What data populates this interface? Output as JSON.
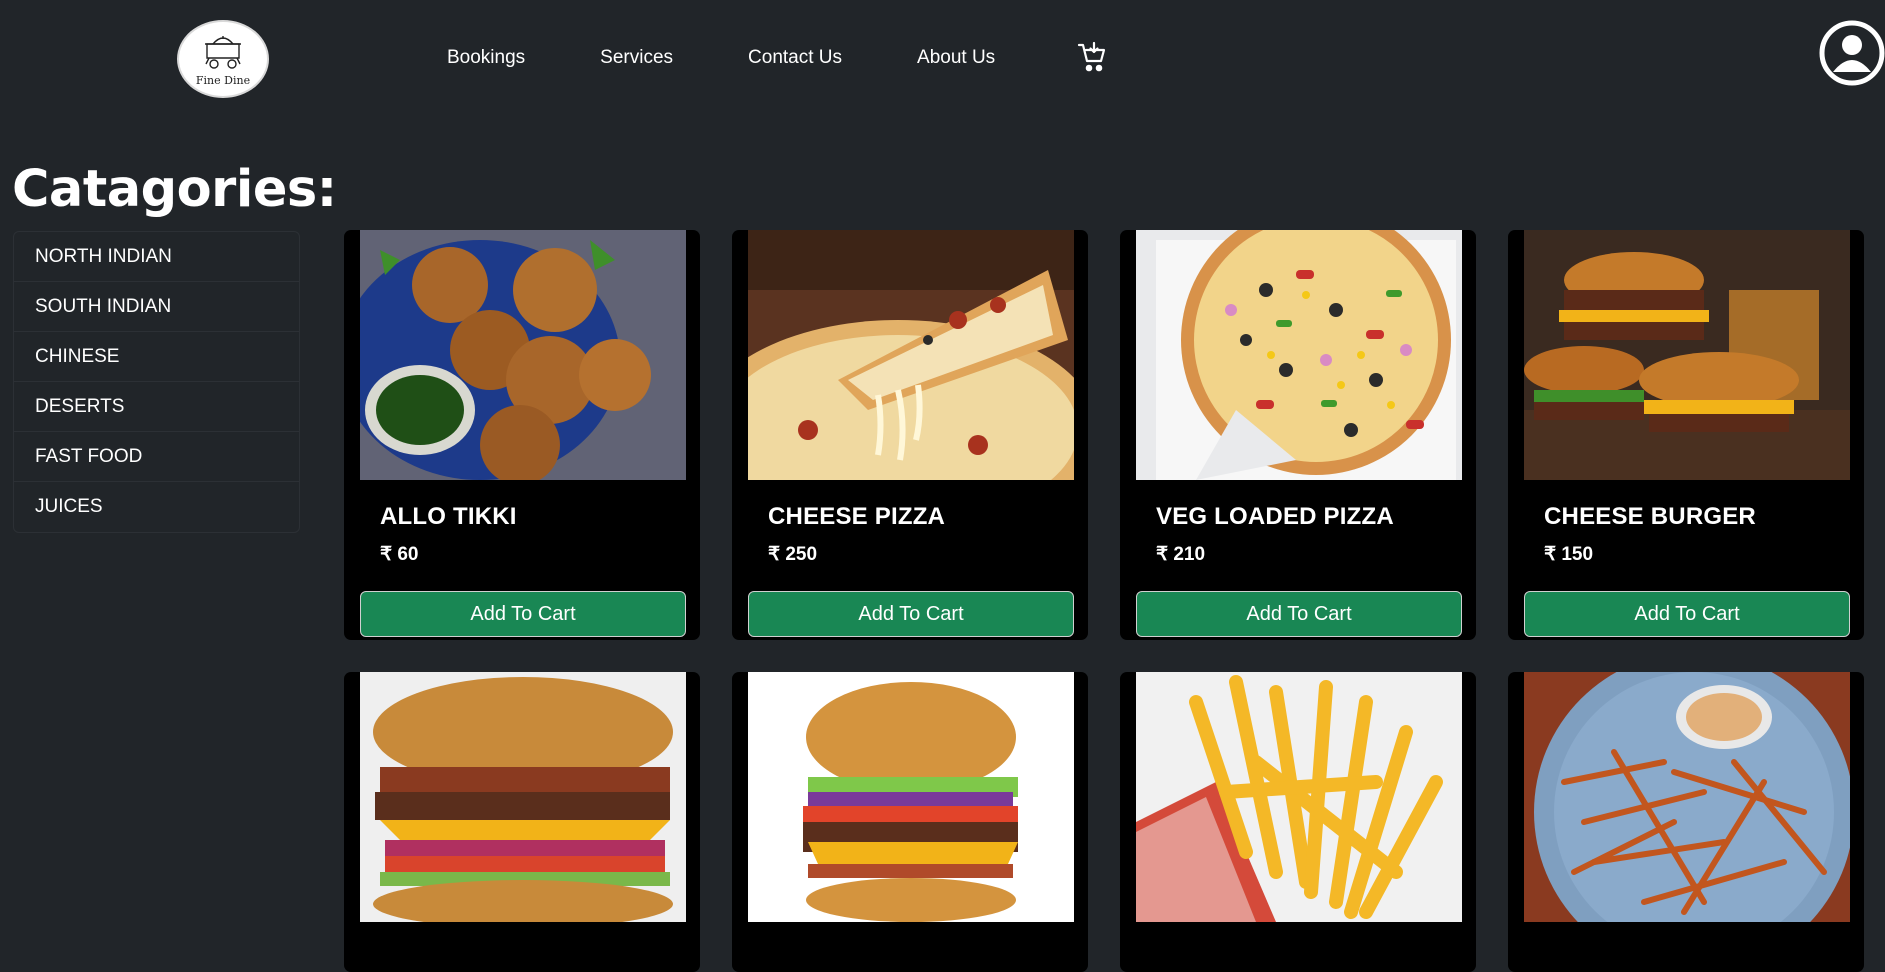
{
  "header": {
    "logo_text": "Fine Dine",
    "nav": [
      "Bookings",
      "Services",
      "Contact Us",
      "About Us"
    ],
    "cart_icon": "cart-icon",
    "profile_icon": "user-circle-icon"
  },
  "categories": {
    "title": "Catagories:",
    "items": [
      "NORTH INDIAN",
      "SOUTH INDIAN",
      "CHINESE",
      "DESERTS",
      "FAST FOOD",
      "JUICES"
    ]
  },
  "products": [
    {
      "name": "ALLO TIKKI",
      "price": "₹ 60",
      "button": "Add To Cart"
    },
    {
      "name": "CHEESE PIZZA",
      "price": "₹ 250",
      "button": "Add To Cart"
    },
    {
      "name": "VEG LOADED PIZZA",
      "price": "₹ 210",
      "button": "Add To Cart"
    },
    {
      "name": "CHEESE BURGER",
      "price": "₹ 150",
      "button": "Add To Cart"
    }
  ],
  "colors": {
    "background": "#212529",
    "card": "#000000",
    "button": "#198754"
  }
}
